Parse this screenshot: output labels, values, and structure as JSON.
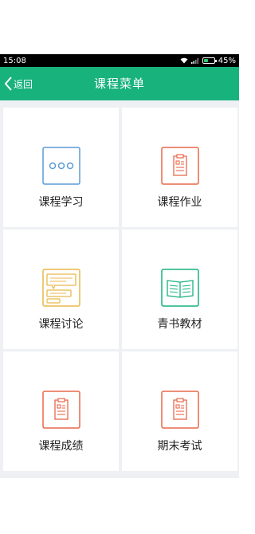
{
  "status_bar": {
    "time": "15:08",
    "battery": "45%",
    "battery_level": 0.45
  },
  "app_bar": {
    "back_label": "返回",
    "title": "课程菜单"
  },
  "menu": [
    {
      "label": "课程学习",
      "icon": "chat-bubble-icon",
      "color": "#5b9bd5"
    },
    {
      "label": "课程作业",
      "icon": "clipboard-icon",
      "color": "#e8684a"
    },
    {
      "label": "课程讨论",
      "icon": "discussion-icon",
      "color": "#e8b94a"
    },
    {
      "label": "青书教材",
      "icon": "open-book-icon",
      "color": "#18b27d"
    },
    {
      "label": "课程成绩",
      "icon": "clipboard-icon",
      "color": "#e8684a"
    },
    {
      "label": "期末考试",
      "icon": "clipboard-icon",
      "color": "#e8684a"
    }
  ]
}
